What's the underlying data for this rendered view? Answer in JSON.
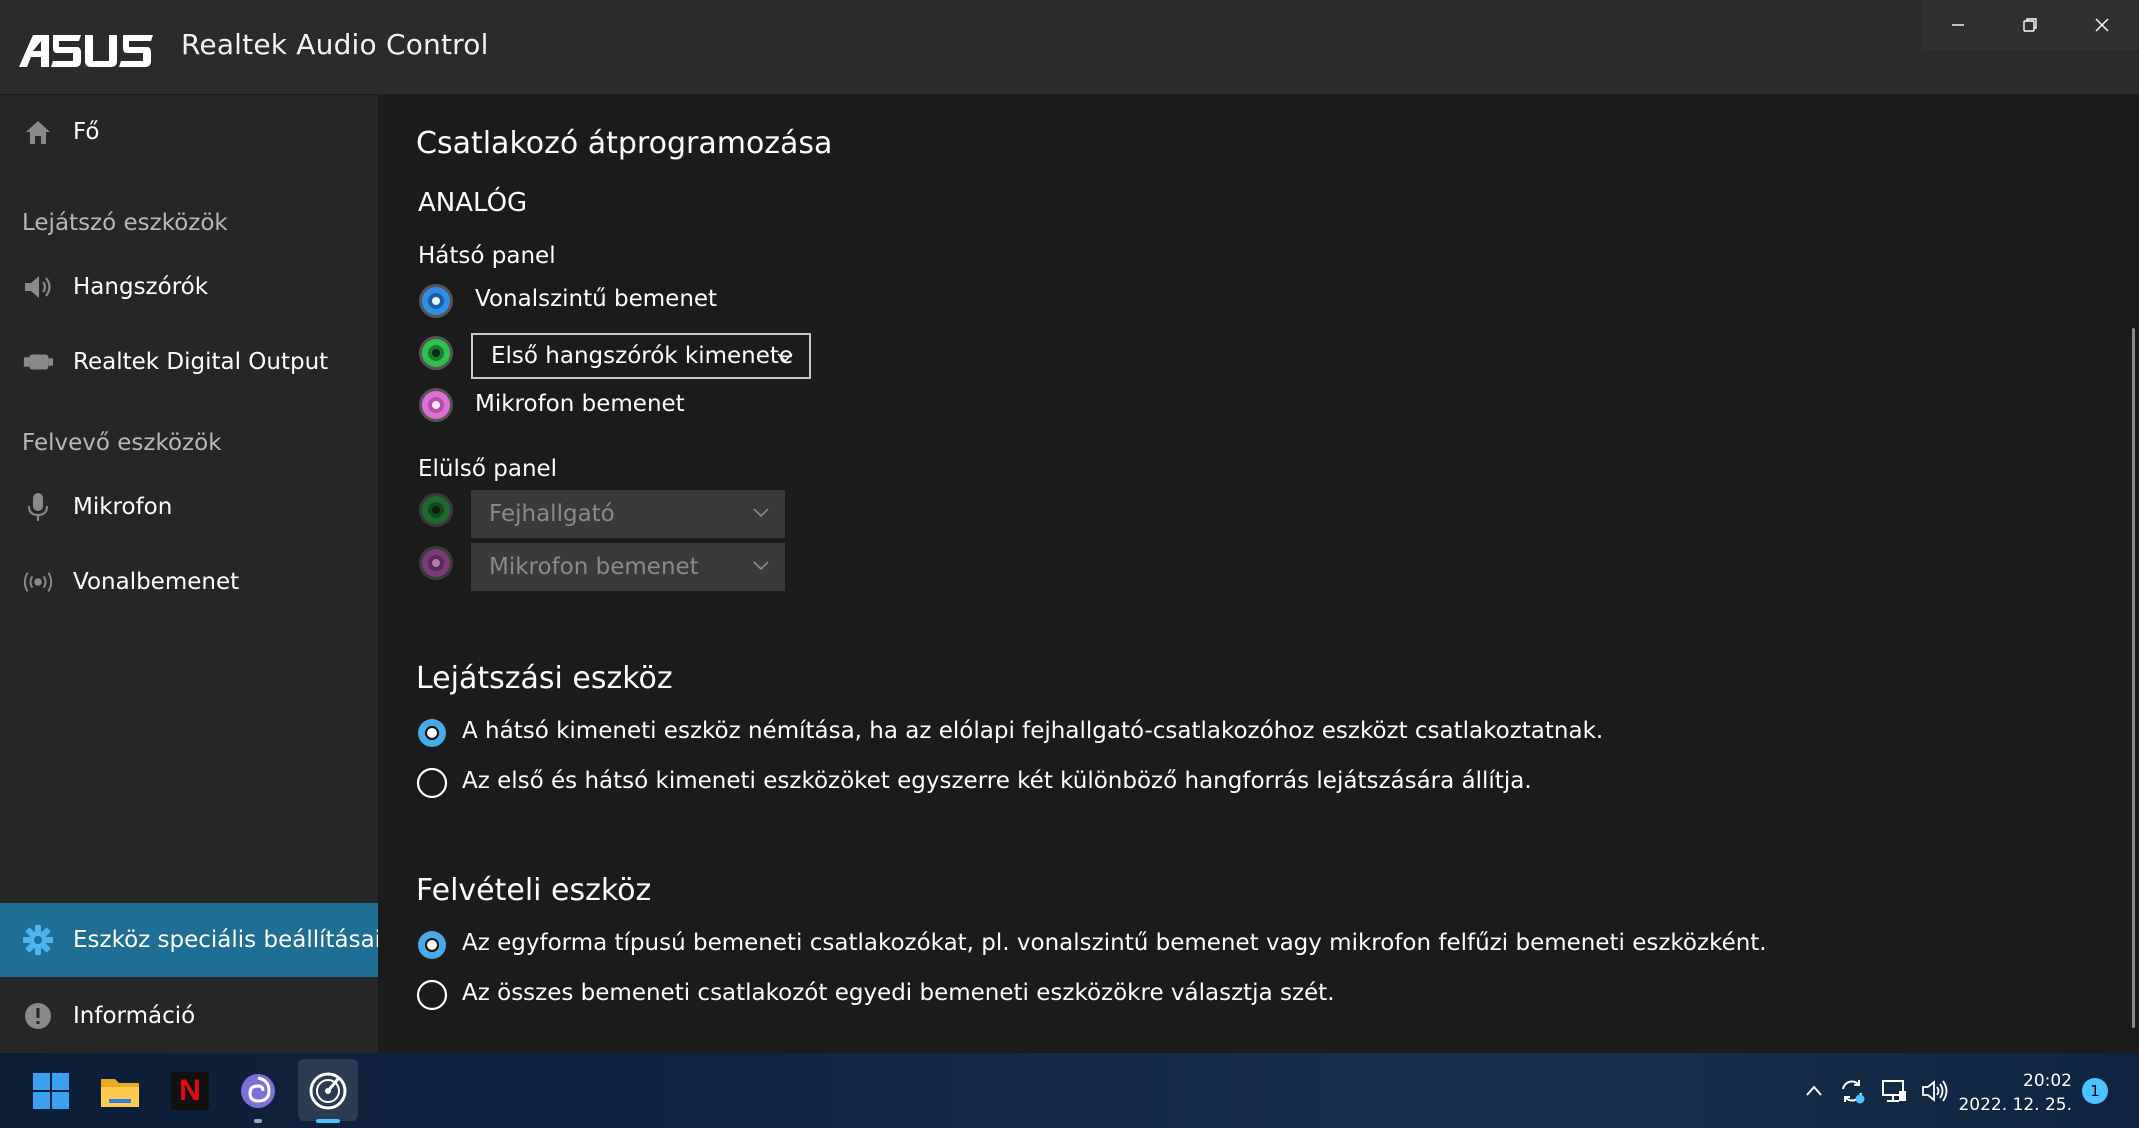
{
  "window": {
    "title": "Realtek Audio Control",
    "logo_text": "ASUS",
    "controls": [
      "minimize-icon",
      "restore-icon",
      "close-icon"
    ]
  },
  "sidebar": {
    "home": {
      "label": "Fő",
      "icon": "home-icon"
    },
    "playback_section": "Lejátszó eszközök",
    "playback_items": [
      {
        "label": "Hangszórók",
        "icon": "speaker-icon"
      },
      {
        "label": "Realtek Digital Output",
        "icon": "digital-output-icon"
      }
    ],
    "recording_section": "Felvevő eszközök",
    "recording_items": [
      {
        "label": "Mikrofon",
        "icon": "microphone-icon"
      },
      {
        "label": "Vonalbemenet",
        "icon": "line-in-icon"
      }
    ],
    "bottom_items": [
      {
        "label": "Eszköz speciális beállításai",
        "icon": "gear-icon",
        "active": true
      },
      {
        "label": "Információ",
        "icon": "info-icon",
        "active": false
      }
    ]
  },
  "main": {
    "title": "Csatlakozó átprogramozása",
    "analog_heading": "ANALÓG",
    "rear_panel": {
      "label": "Hátsó panel",
      "jacks": [
        {
          "color": "#2f8fe8",
          "type": "text",
          "label": "Vonalszintű bemenet"
        },
        {
          "color": "#2ec24a",
          "type": "dropdown",
          "value": "Első hangszórók kimenete"
        },
        {
          "color": "#e070d8",
          "type": "text",
          "label": "Mikrofon bemenet"
        }
      ]
    },
    "front_panel": {
      "label": "Elülső panel",
      "jacks": [
        {
          "color": "#1e6a2e",
          "type": "dropdown-disabled",
          "value": "Fejhallgató"
        },
        {
          "color": "#7a3a78",
          "type": "dropdown-disabled",
          "value": "Mikrofon bemenet"
        }
      ]
    },
    "playback_device": {
      "heading": "Lejátszási eszköz",
      "options": [
        {
          "label": "A hátsó kimeneti eszköz némítása, ha az elólapi fejhallgató-csatlakozóhoz eszközt csatlakoztatnak.",
          "selected": true
        },
        {
          "label": "Az első és hátsó kimeneti eszközöket egyszerre két különböző hangforrás lejátszására állítja.",
          "selected": false
        }
      ]
    },
    "recording_device": {
      "heading": "Felvételi eszköz",
      "options": [
        {
          "label": "Az egyforma típusú bemeneti csatlakozókat, pl. vonalszintű bemenet vagy mikrofon felfűzi bemeneti eszközként.",
          "selected": true
        },
        {
          "label": "Az összes bemeneti csatlakozót egyedi bemeneti eszközökre választja szét.",
          "selected": false
        }
      ]
    }
  },
  "taskbar": {
    "apps": [
      "windows-start-icon",
      "file-explorer-icon",
      "netflix-icon",
      "app-swirl-icon",
      "realtek-audio-icon"
    ],
    "netflix_letter": "N",
    "tray": [
      "chevron-up-icon",
      "sync-icon",
      "network-icon",
      "volume-icon"
    ],
    "time": "20:02",
    "date": "2022. 12. 25.",
    "notification_count": "1"
  },
  "colors": {
    "accent": "#1f6f95",
    "radio_selected": "#4aa8e8",
    "sidebar_bg": "#262626",
    "main_bg": "#1b1b1b"
  }
}
